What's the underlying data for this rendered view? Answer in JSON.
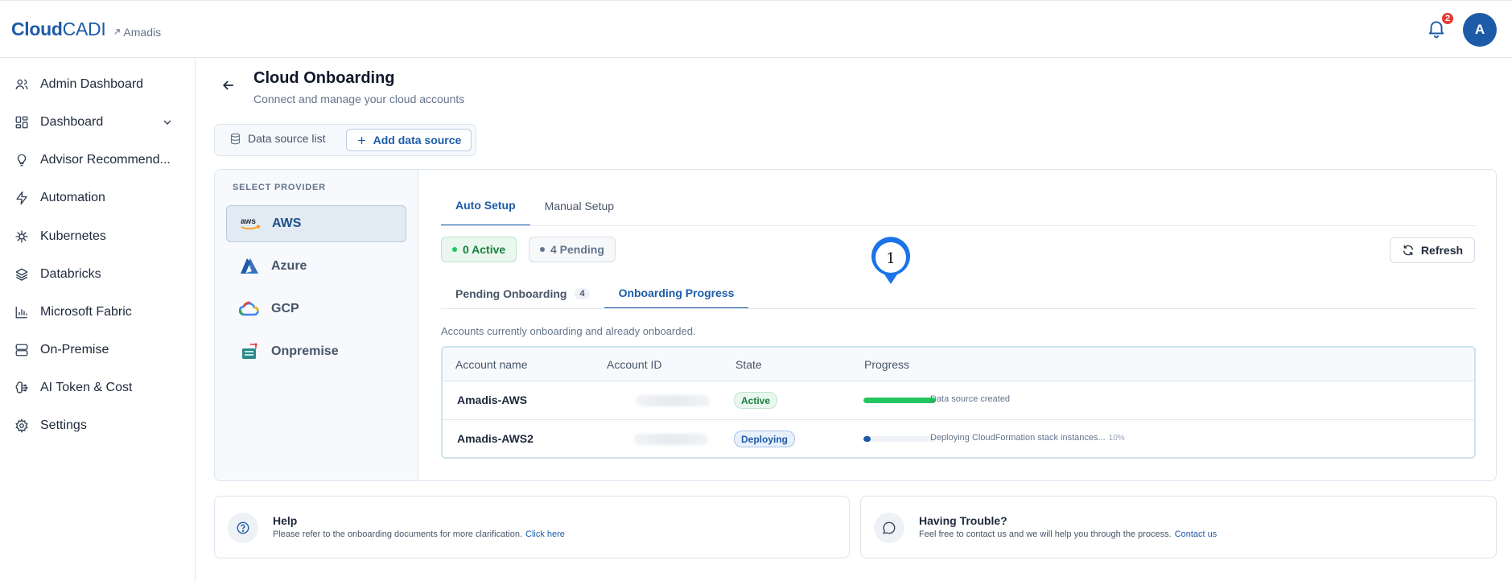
{
  "brand": {
    "name_bold": "Cloud",
    "name_light": "CADI",
    "org": "Amadis"
  },
  "header": {
    "notifications_count": "2",
    "avatar_initial": "A"
  },
  "sidebar": {
    "items": [
      {
        "label": "Admin Dashboard",
        "icon": "users-icon"
      },
      {
        "label": "Dashboard",
        "icon": "grid-icon"
      },
      {
        "label": "Advisor Recommend...",
        "icon": "lightbulb-icon"
      },
      {
        "label": "Automation",
        "icon": "bolt-icon"
      },
      {
        "label": "Kubernetes",
        "icon": "helm-icon"
      },
      {
        "label": "Databricks",
        "icon": "layers-icon"
      },
      {
        "label": "Microsoft Fabric",
        "icon": "bar-chart-icon"
      },
      {
        "label": "On-Premise",
        "icon": "server-icon"
      },
      {
        "label": "AI Token & Cost",
        "icon": "brain-icon"
      },
      {
        "label": "Settings",
        "icon": "gear-icon"
      }
    ]
  },
  "page": {
    "title": "Cloud Onboarding",
    "subtitle": "Connect and manage your cloud accounts"
  },
  "datasource": {
    "list_label": "Data source list",
    "add_label": "Add data source"
  },
  "providers": {
    "title": "SELECT PROVIDER",
    "items": [
      {
        "label": "AWS",
        "active": true
      },
      {
        "label": "Azure",
        "active": false
      },
      {
        "label": "GCP",
        "active": false
      },
      {
        "label": "Onpremise",
        "active": false
      }
    ]
  },
  "setup_tabs": {
    "auto": "Auto Setup",
    "manual": "Manual Setup"
  },
  "status": {
    "active": "0 Active",
    "pending": "4 Pending"
  },
  "refresh_label": "Refresh",
  "sub_tabs": {
    "pending": "Pending Onboarding",
    "pending_count": "4",
    "progress": "Onboarding Progress"
  },
  "marker_number": "1",
  "accounts_note": "Accounts currently onboarding and already onboarded.",
  "table": {
    "columns": [
      "Account name",
      "Account ID",
      "State",
      "Progress"
    ],
    "rows": [
      {
        "name": "Amadis-AWS",
        "state": "Active",
        "progress": 100,
        "progress_text": "Data source created",
        "percent": ""
      },
      {
        "name": "Amadis-AWS2",
        "state": "Deploying",
        "progress": 10,
        "progress_text": "Deploying CloudFormation stack instances...",
        "percent": "10%"
      }
    ]
  },
  "help_card": {
    "title": "Help",
    "text": "Please refer to the onboarding documents for more clarification.",
    "link": "Click here"
  },
  "trouble_card": {
    "title": "Having Trouble?",
    "text": "Feel free to contact us and we will help you through the process.",
    "link": "Contact us"
  },
  "colors": {
    "brand": "#1d5ba8",
    "success": "#22c55e",
    "danger": "#e53935"
  }
}
